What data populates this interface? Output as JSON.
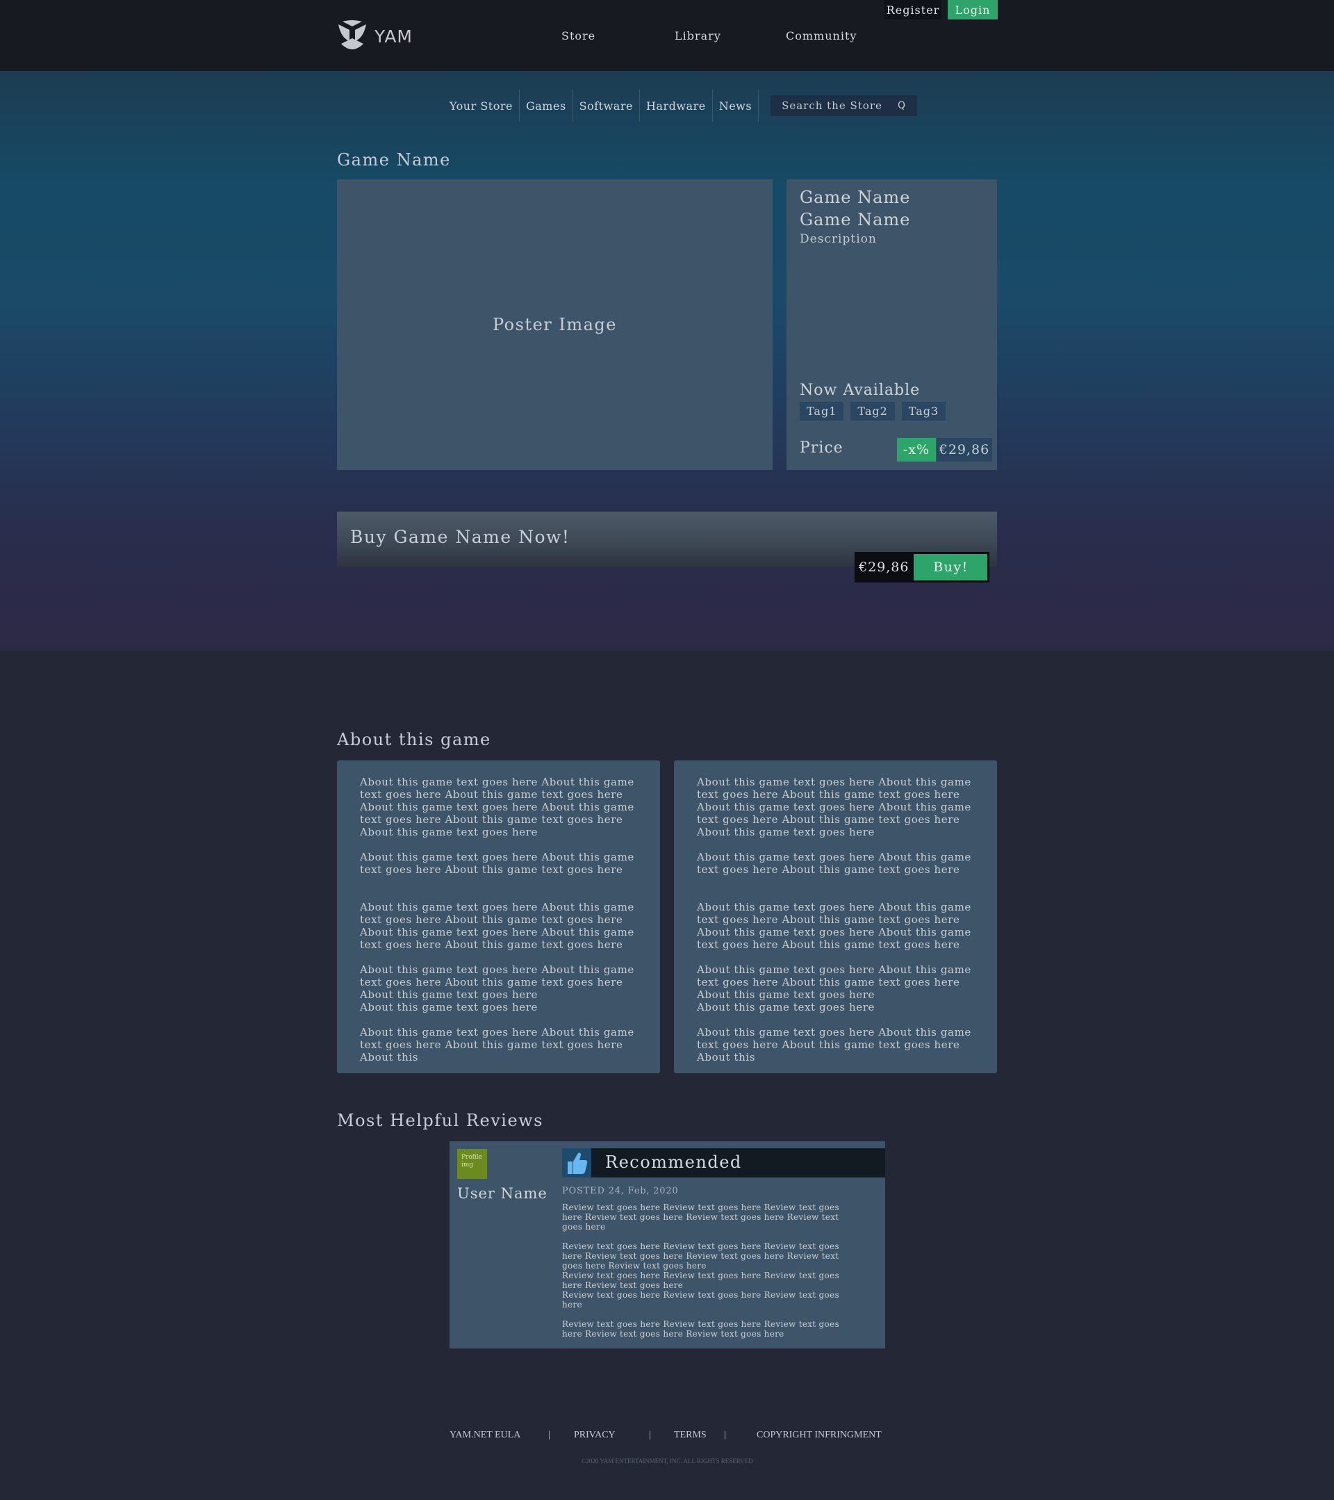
{
  "header": {
    "logo_text": "YAM",
    "nav": [
      "Store",
      "Library",
      "Community"
    ],
    "register_label": "Register",
    "login_label": "Login"
  },
  "subnav": {
    "items": [
      "Your Store",
      "Games",
      "Software",
      "Hardware",
      "News"
    ],
    "search_placeholder": "Search the Store",
    "search_icon_glyph": "Q"
  },
  "game": {
    "page_title": "Game Name",
    "poster_text": "Poster Image",
    "title_line1": "Game Name",
    "title_line2": "Game Name",
    "description": "Description",
    "availability": "Now Available",
    "tags": [
      "Tag1",
      "Tag2",
      "Tag3"
    ],
    "price_label": "Price",
    "discount": "-x%",
    "price": "€29,86"
  },
  "buy": {
    "title": "Buy Game Name Now!",
    "price": "€29,86",
    "button_label": "Buy!"
  },
  "about": {
    "title": "About this game",
    "columns": [
      {
        "paragraphs": [
          "About this game text goes here About this game text goes here About this game text goes here About this game text goes here About this game text goes here About this game text goes here About this game text goes here",
          "About this game text goes here About this game text goes here About this game text goes here",
          "About this game text goes here About this game text goes here About this game text goes here About this game text goes here About this game text goes here About this game text goes here",
          "About this game text goes here About this game text goes here About this game text goes here About this game text goes here",
          "About this game text goes here",
          "About this game text goes here About this game text goes here About this game text goes here About this"
        ]
      },
      {
        "paragraphs": [
          "About this game text goes here About this game text goes here About this game text goes here About this game text goes here About this game text goes here About this game text goes here About this game text goes here",
          "About this game text goes here About this game text goes here About this game text goes here",
          "About this game text goes here About this game text goes here About this game text goes here About this game text goes here About this game text goes here About this game text goes here",
          "About this game text goes here About this game text goes here About this game text goes here About this game text goes here",
          "About this game text goes here",
          "About this game text goes here About this game text goes here About this game text goes here About this"
        ]
      }
    ]
  },
  "reviews": {
    "title": "Most Helpful Reviews",
    "items": [
      {
        "profile_img_text": "Profile img",
        "user_name": "User Name",
        "verdict": "Recommended",
        "posted": "POSTED 24, Feb, 2020",
        "paragraphs": [
          "Review text goes here Review text goes here Review text goes here Review text goes here Review text goes here Review text goes here",
          "Review text goes here Review text goes here Review text goes here Review text goes here Review text goes here Review text goes here Review text goes here",
          "Review text goes here Review text goes here Review text goes here Review text goes here",
          "Review text goes here Review text goes here Review text goes here",
          "Review text goes here Review text goes here Review text goes here Review text goes here Review text goes here"
        ]
      }
    ]
  },
  "footer": {
    "links": [
      "YAM.NET EULA",
      "PRIVACY",
      "TERMS",
      "COPYRIGHT INFRINGMENT"
    ],
    "separator": "|",
    "copyright": "©2020 YAM ENTERTAINMENT, INC. ALL RIGHTS RESERVED"
  },
  "colors": {
    "accent_green": "#2ea36a",
    "topbar": "#171a21",
    "panel": "#3e5569",
    "page_bg": "#232736"
  },
  "icons": [
    "yam-logo-icon",
    "search-icon",
    "thumbs-up-icon"
  ]
}
